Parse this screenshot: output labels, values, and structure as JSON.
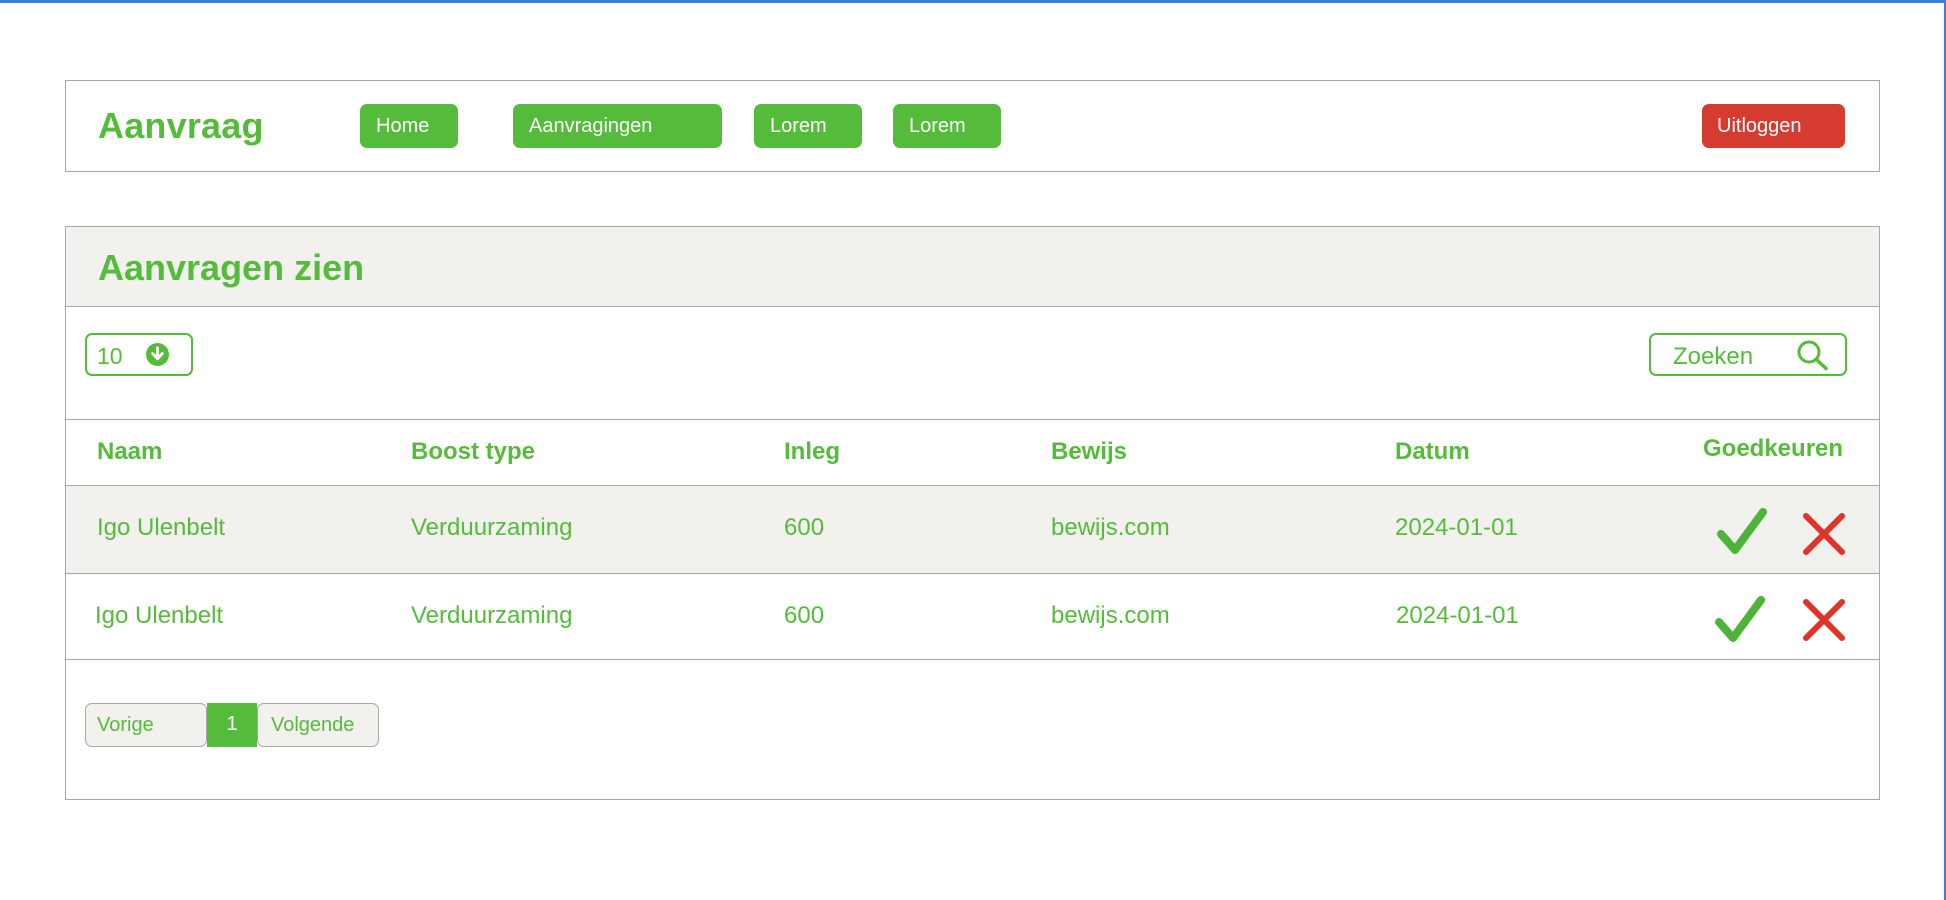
{
  "header": {
    "brand": "Aanvraag",
    "nav": [
      {
        "label": "Home"
      },
      {
        "label": "Aanvragingen"
      },
      {
        "label": "Lorem"
      },
      {
        "label": "Lorem"
      }
    ],
    "logout_label": "Uitloggen"
  },
  "panel": {
    "title": "Aanvragen zien",
    "page_size": "10",
    "search_placeholder": "Zoeken",
    "columns": [
      "Naam",
      "Boost type",
      "Inleg",
      "Bewijs",
      "Datum",
      "Goedkeuren"
    ],
    "rows": [
      {
        "naam": "Igo Ulenbelt",
        "boost_type": "Verduurzaming",
        "inleg": "600",
        "bewijs": "bewijs.com",
        "datum": "2024-01-01"
      },
      {
        "naam": "Igo Ulenbelt",
        "boost_type": "Verduurzaming",
        "inleg": "600",
        "bewijs": "bewijs.com",
        "datum": "2024-01-01"
      }
    ],
    "pagination": {
      "prev_label": "Vorige",
      "current_page": "1",
      "next_label": "Volgende"
    }
  },
  "icons": {
    "dropdown": "download-circle-icon",
    "search": "search-icon",
    "approve": "check-icon",
    "reject": "close-icon"
  },
  "colors": {
    "accent": "#55bb3a",
    "danger": "#d63b2f",
    "panel_bg": "#f2f1ee",
    "border": "#a8a8a8"
  }
}
